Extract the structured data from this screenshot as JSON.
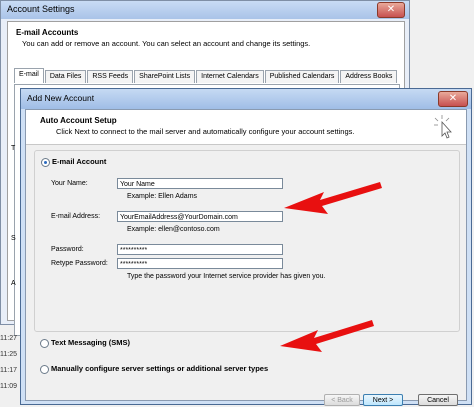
{
  "background_window": {
    "title": "Account Settings",
    "close_symbol": "✕",
    "heading": "E-mail Accounts",
    "description": "You can add or remove an account. You can select an account and change its settings.",
    "tabs": [
      "E-mail",
      "Data Files",
      "RSS Feeds",
      "SharePoint Lists",
      "Internet Calendars",
      "Published Calendars",
      "Address Books"
    ],
    "side_letters": [
      "T",
      "S",
      "A"
    ],
    "times": [
      "11:27",
      "11:25",
      "11:17",
      "11:09"
    ]
  },
  "dialog": {
    "title": "Add New Account",
    "close_symbol": "✕",
    "header_title": "Auto Account Setup",
    "header_subtitle": "Click Next to connect to the mail server and automatically configure your account settings.",
    "email_option": "E-mail Account",
    "fields": {
      "name_label": "Your Name:",
      "name_value": "Your Name",
      "name_hint": "Example: Ellen Adams",
      "email_label": "E-mail Address:",
      "email_value": "YourEmailAddress@YourDomain.com",
      "email_hint": "Example: ellen@contoso.com",
      "password_label": "Password:",
      "password_value": "**********",
      "retype_label": "Retype Password:",
      "retype_value": "**********",
      "password_hint": "Type the password your Internet service provider has given you."
    },
    "sms_option": "Text Messaging (SMS)",
    "manual_option": "Manually configure server settings or additional server types",
    "buttons": {
      "back": "< Back",
      "next": "Next >",
      "cancel": "Cancel"
    }
  },
  "colors": {
    "arrow": "#e81010",
    "accent": "#2c6bbf"
  }
}
